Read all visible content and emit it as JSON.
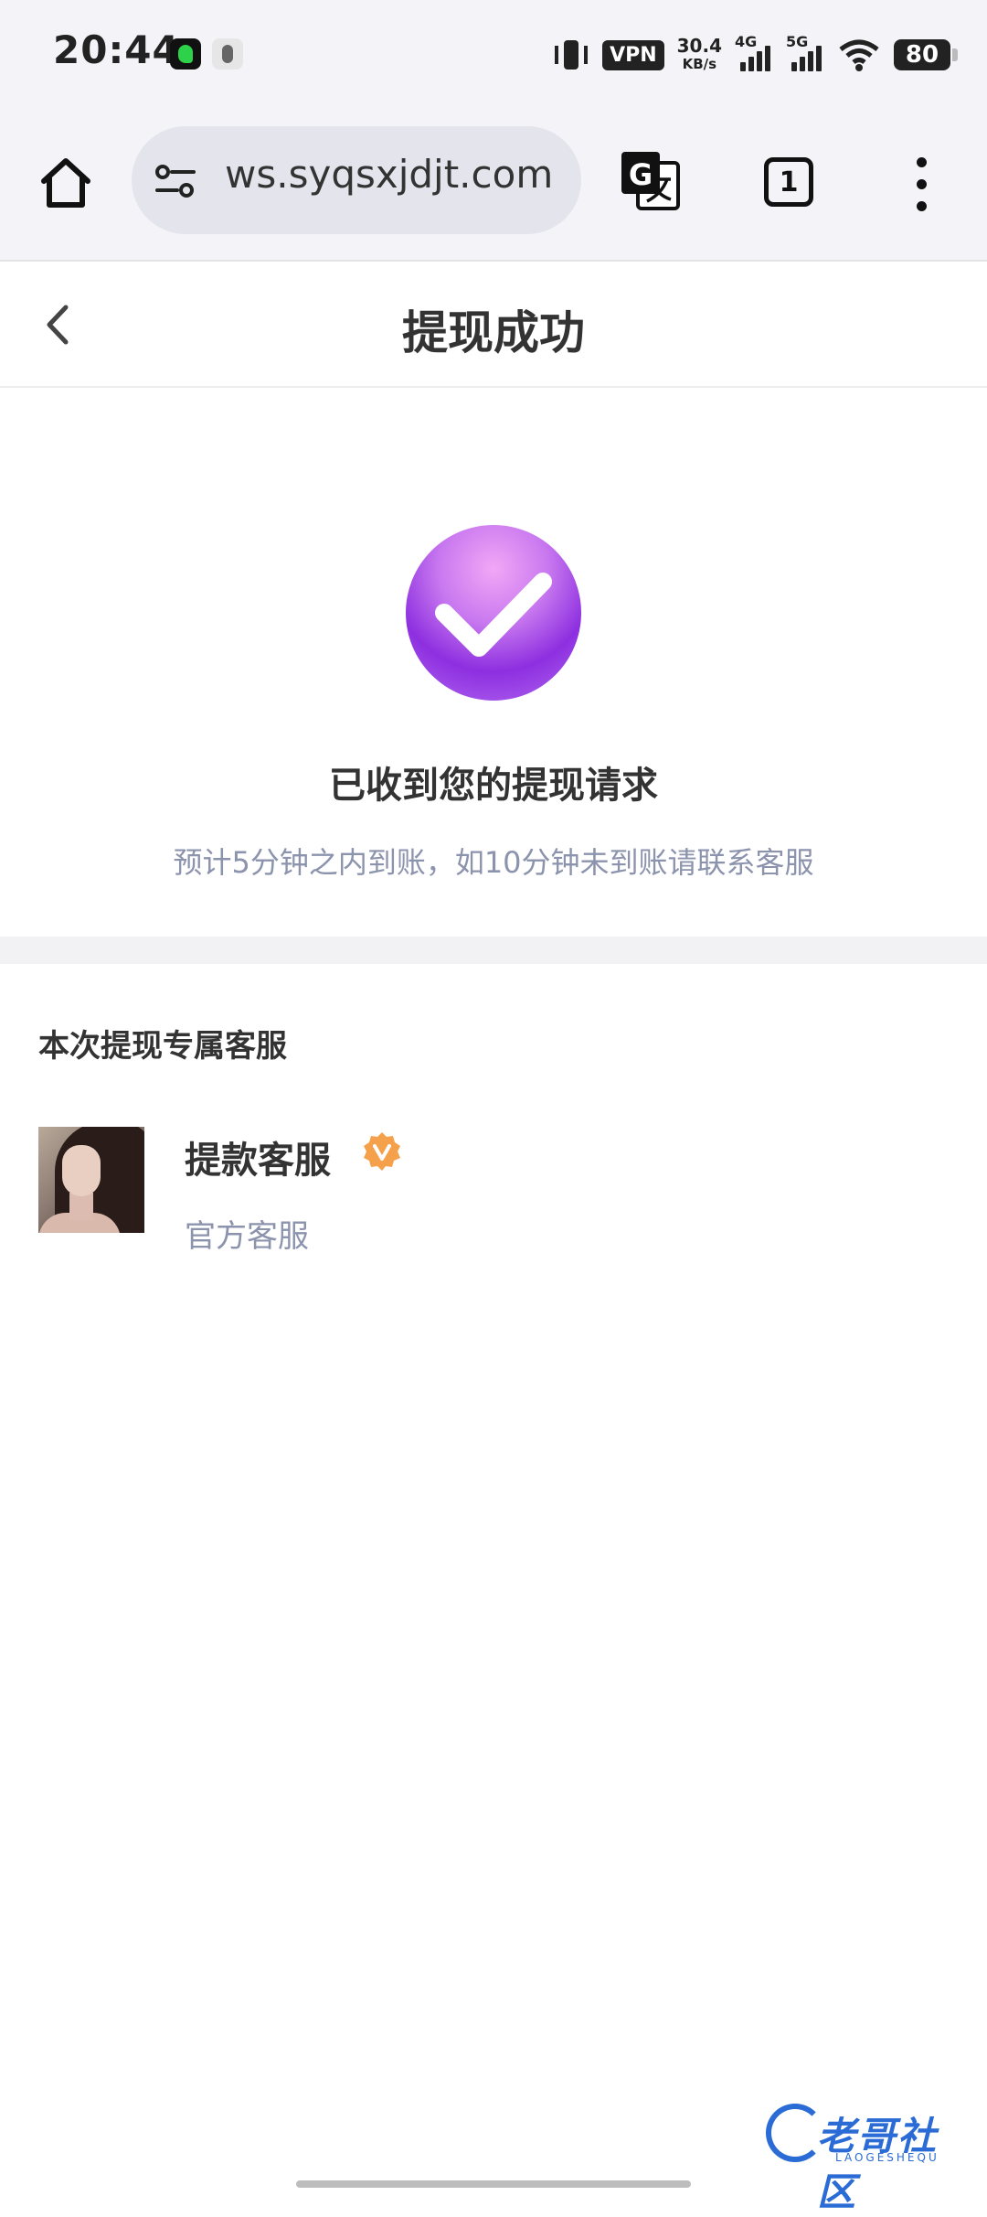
{
  "status_bar": {
    "time": "20:44",
    "vpn": "VPN",
    "net_speed_value": "30.4",
    "net_speed_unit": "KB/s",
    "signal_1_label": "4G",
    "signal_2_label": "5G",
    "battery": "80"
  },
  "browser": {
    "url": "ws.syqsxjdjt.com",
    "tab_count": "1"
  },
  "header": {
    "title": "提现成功"
  },
  "success": {
    "title": "已收到您的提现请求",
    "subtitle": "预计5分钟之内到账，如10分钟未到账请联系客服"
  },
  "service": {
    "heading": "本次提现专属客服",
    "name": "提款客服",
    "role": "官方客服"
  },
  "watermark": {
    "text": "老哥社区",
    "sub": "LAOGESHEQU"
  },
  "colors": {
    "accent_purple": "#9a3ee6",
    "muted_text": "#8c93ad",
    "verified_orange": "#f5a04a"
  }
}
